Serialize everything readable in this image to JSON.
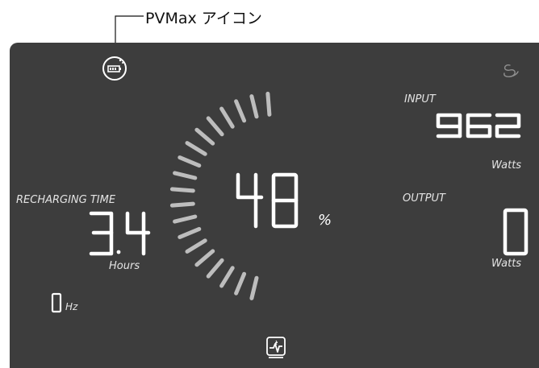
{
  "callout": {
    "label": "PVMax アイコン"
  },
  "panel": {
    "battery_percent": 48,
    "percent_unit": "%",
    "input": {
      "label": "INPUT",
      "value": "962",
      "unit": "Watts"
    },
    "output": {
      "label": "OUTPUT",
      "value": "0",
      "unit": "Watts"
    },
    "recharging": {
      "label": "RECHARGING TIME",
      "value": "3.4",
      "unit": "Hours"
    },
    "frequency": {
      "value": "0",
      "unit": "Hz"
    },
    "ring_segments_total": 40,
    "icons": {
      "pvmax": "pvmax-battery-icon",
      "fan": "fan-icon",
      "bottom": "ac-output-icon"
    },
    "colors": {
      "background": "#3d3d3d",
      "ring_segment": "#bdbdbd",
      "digit": "#ffffff",
      "label": "#e4e4e4"
    }
  }
}
